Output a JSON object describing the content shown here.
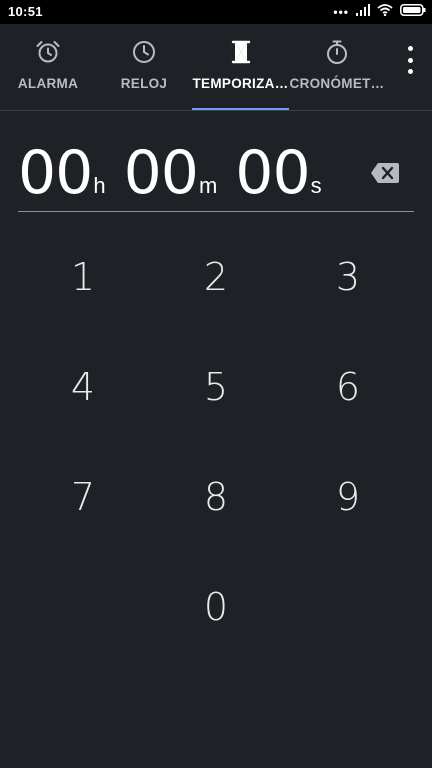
{
  "status_bar": {
    "time": "10:51",
    "indicator_dots": "•••"
  },
  "tabs": [
    {
      "label": "ALARMA",
      "icon": "alarm-clock-icon",
      "active": false
    },
    {
      "label": "RELOJ",
      "icon": "clock-icon",
      "active": false
    },
    {
      "label": "TEMPORIZA…",
      "icon": "hourglass-icon",
      "active": true
    },
    {
      "label": "CRONÓMET…",
      "icon": "stopwatch-icon",
      "active": false
    }
  ],
  "timer": {
    "hours": "00",
    "hours_unit": "h",
    "minutes": "00",
    "minutes_unit": "m",
    "seconds": "00",
    "seconds_unit": "s"
  },
  "keypad": {
    "keys": [
      "1",
      "2",
      "3",
      "4",
      "5",
      "6",
      "7",
      "8",
      "9",
      "0"
    ]
  },
  "colors": {
    "background": "#1e2126",
    "accent": "#6d9ff3",
    "text": "#ffffff",
    "inactive_tab": "#b9bcc2"
  }
}
